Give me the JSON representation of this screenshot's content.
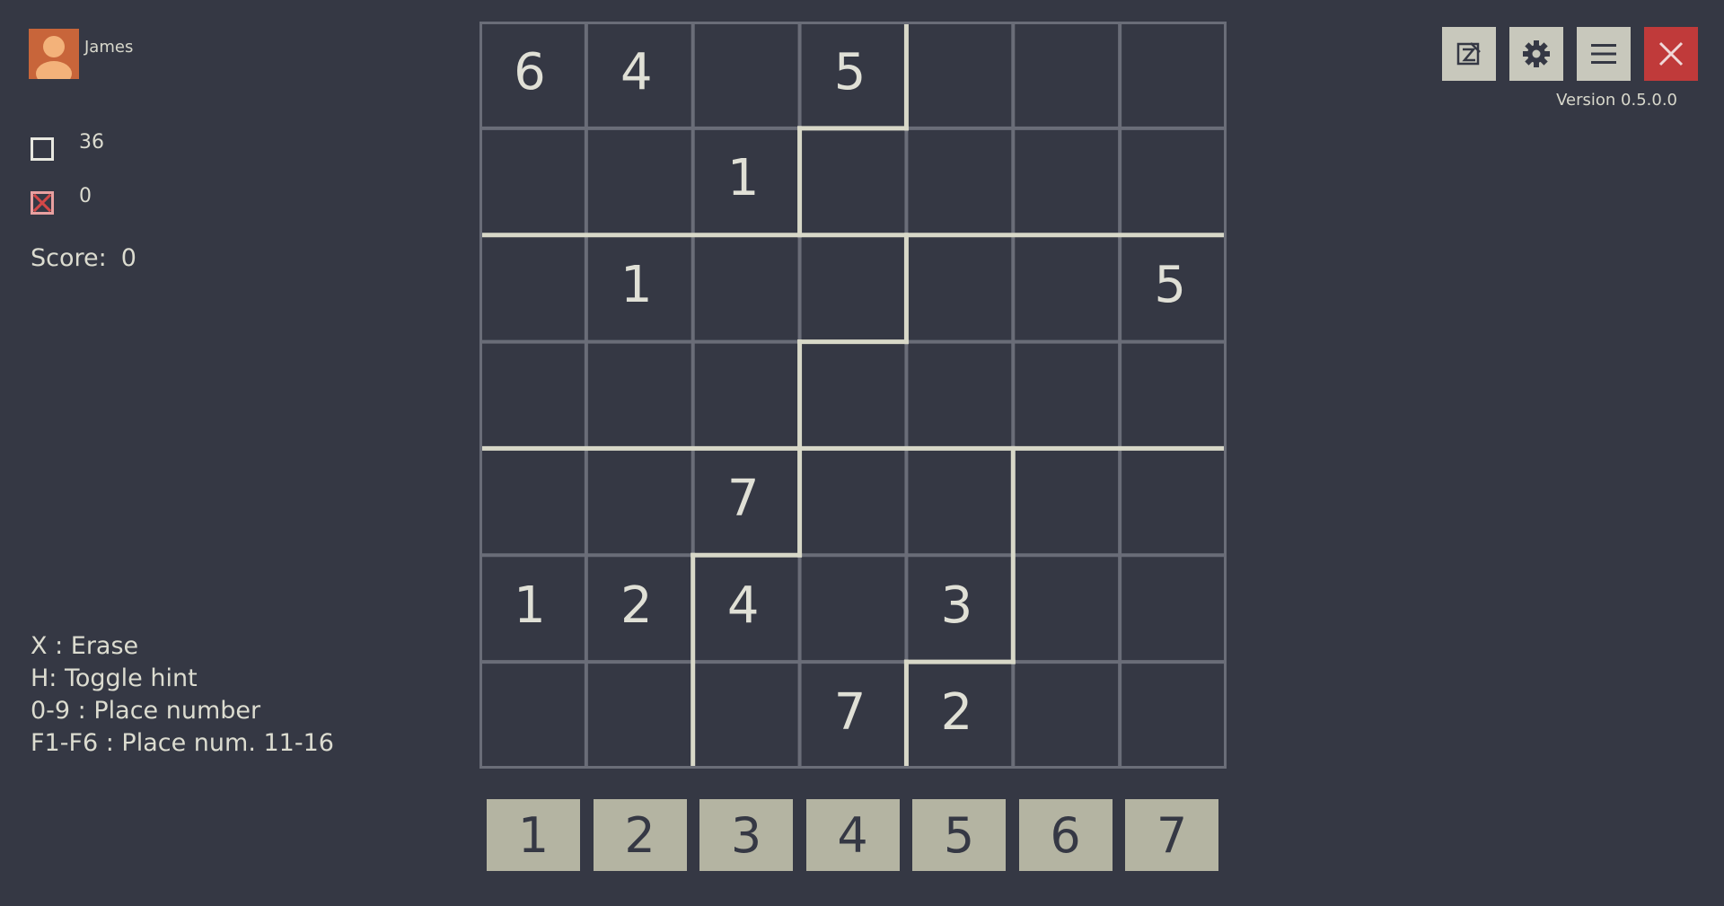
{
  "user": {
    "name": "James"
  },
  "stats": {
    "remaining": "36",
    "errors": "0"
  },
  "score": {
    "label": "Score:",
    "value": "0"
  },
  "hints": [
    "X : Erase",
    "H: Toggle hint",
    "0-9 : Place number",
    "F1-F6 : Place num. 11-16"
  ],
  "version": "Version 0.5.0.0",
  "board": [
    [
      "6",
      "4",
      "",
      "5",
      "",
      "",
      ""
    ],
    [
      "",
      "",
      "1",
      "",
      "",
      "",
      ""
    ],
    [
      "",
      "1",
      "",
      "",
      "",
      "",
      "5"
    ],
    [
      "",
      "",
      "",
      "",
      "",
      "",
      ""
    ],
    [
      "",
      "",
      "7",
      "",
      "",
      "",
      ""
    ],
    [
      "1",
      "2",
      "4",
      "",
      "3",
      "",
      ""
    ],
    [
      "",
      "",
      "",
      "7",
      "2",
      "",
      ""
    ]
  ],
  "number_pad": [
    "1",
    "2",
    "3",
    "4",
    "5",
    "6",
    "7"
  ],
  "toolbar": {
    "icons": [
      "edit-icon",
      "gear-icon",
      "menu-icon",
      "close-icon"
    ]
  },
  "colors": {
    "background": "#353844",
    "region_border": "#d8d8c8",
    "cell_border": "#6a6d78",
    "pad": "#b4b4a2",
    "close": "#c03a3a",
    "avatar": "#c8653a"
  }
}
